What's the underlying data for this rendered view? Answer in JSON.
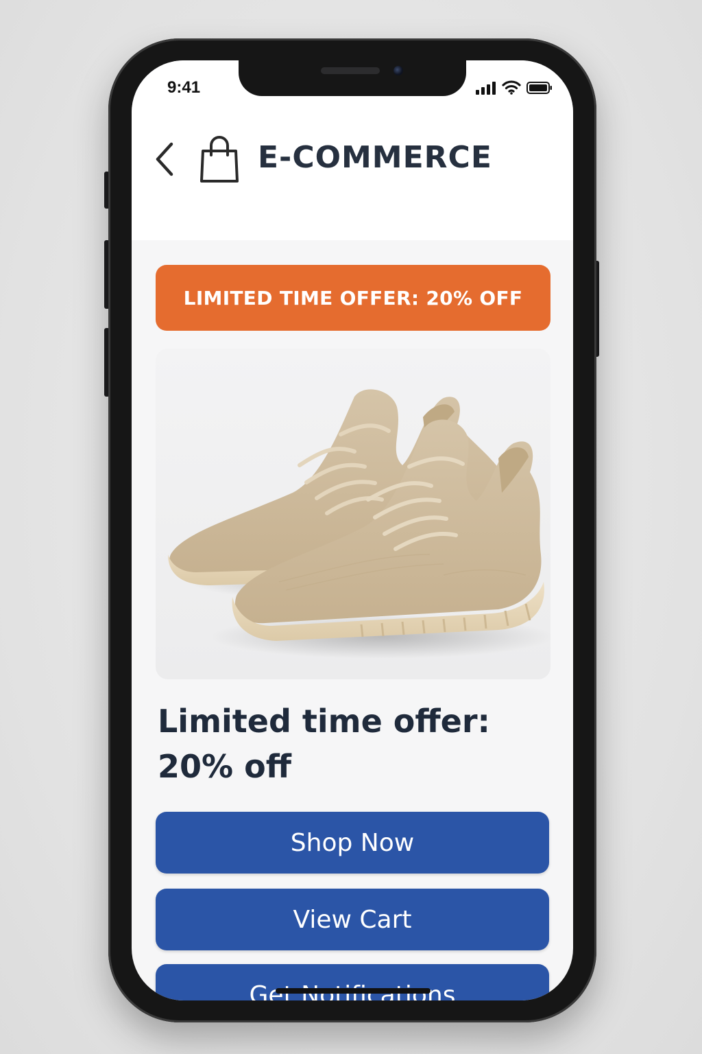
{
  "status_bar": {
    "time": "9:41",
    "icons": [
      "signal-icon",
      "wifi-icon",
      "battery-icon"
    ]
  },
  "header": {
    "back_icon": "chevron-left-icon",
    "logo_icon": "shopping-bag-icon",
    "title": "E-COMMERCE"
  },
  "banner": {
    "text": "LIMITED TIME OFFER: 20% OFF",
    "color": "#e56c2f"
  },
  "product": {
    "image": "beige-knit-sneakers"
  },
  "headline": {
    "line1": "Limited time offer:",
    "line2": "20% off"
  },
  "actions": {
    "shop_now": "Shop Now",
    "view_cart": "View Cart",
    "get_notifications": "Get Notifications",
    "color": "#2b55a7"
  }
}
